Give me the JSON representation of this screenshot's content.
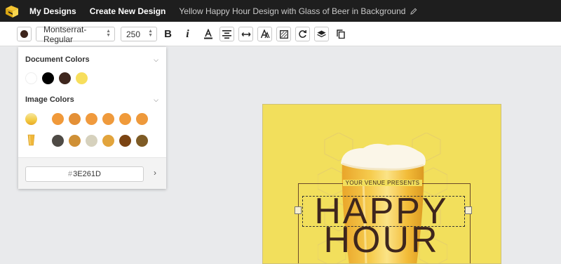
{
  "topbar": {
    "my_designs": "My Designs",
    "create_new": "Create New Design",
    "doc_title": "Yellow Happy Hour Design with Glass of Beer in Background"
  },
  "toolbar": {
    "font_family": "Montserrat-Regular",
    "font_size": "250",
    "bold_glyph": "B",
    "italic_glyph": "i",
    "current_color": "#3E261D",
    "icons": [
      "bold-icon",
      "italic-icon",
      "text-color-icon",
      "align-center-icon",
      "letter-spacing-icon",
      "text-outline-icon",
      "texture-icon",
      "rotate-icon",
      "layers-icon",
      "duplicate-icon"
    ]
  },
  "color_panel": {
    "document_colors_title": "Document Colors",
    "document_colors": [
      "#ffffff",
      "#000000",
      "#3E261D",
      "#f7de5c"
    ],
    "image_colors_title": "Image Colors",
    "image_color_rows": [
      [
        "#f0993a",
        "#e49036",
        "#f09a3d",
        "#ef9a3c",
        "#f09a3a",
        "#ee993b"
      ],
      [
        "#4e4a45",
        "#cf9036",
        "#d6d1bd",
        "#e2a43c",
        "#7b4413",
        "#7e5b25"
      ]
    ],
    "hex_value": "3E261D",
    "hash": "#"
  },
  "design": {
    "venue_text": "YOUR VENUE PRESENTS",
    "headline_1": "HAPPY",
    "headline_2": "HOUR",
    "background_color": "#f2df5c",
    "text_color": "#3E261D"
  }
}
